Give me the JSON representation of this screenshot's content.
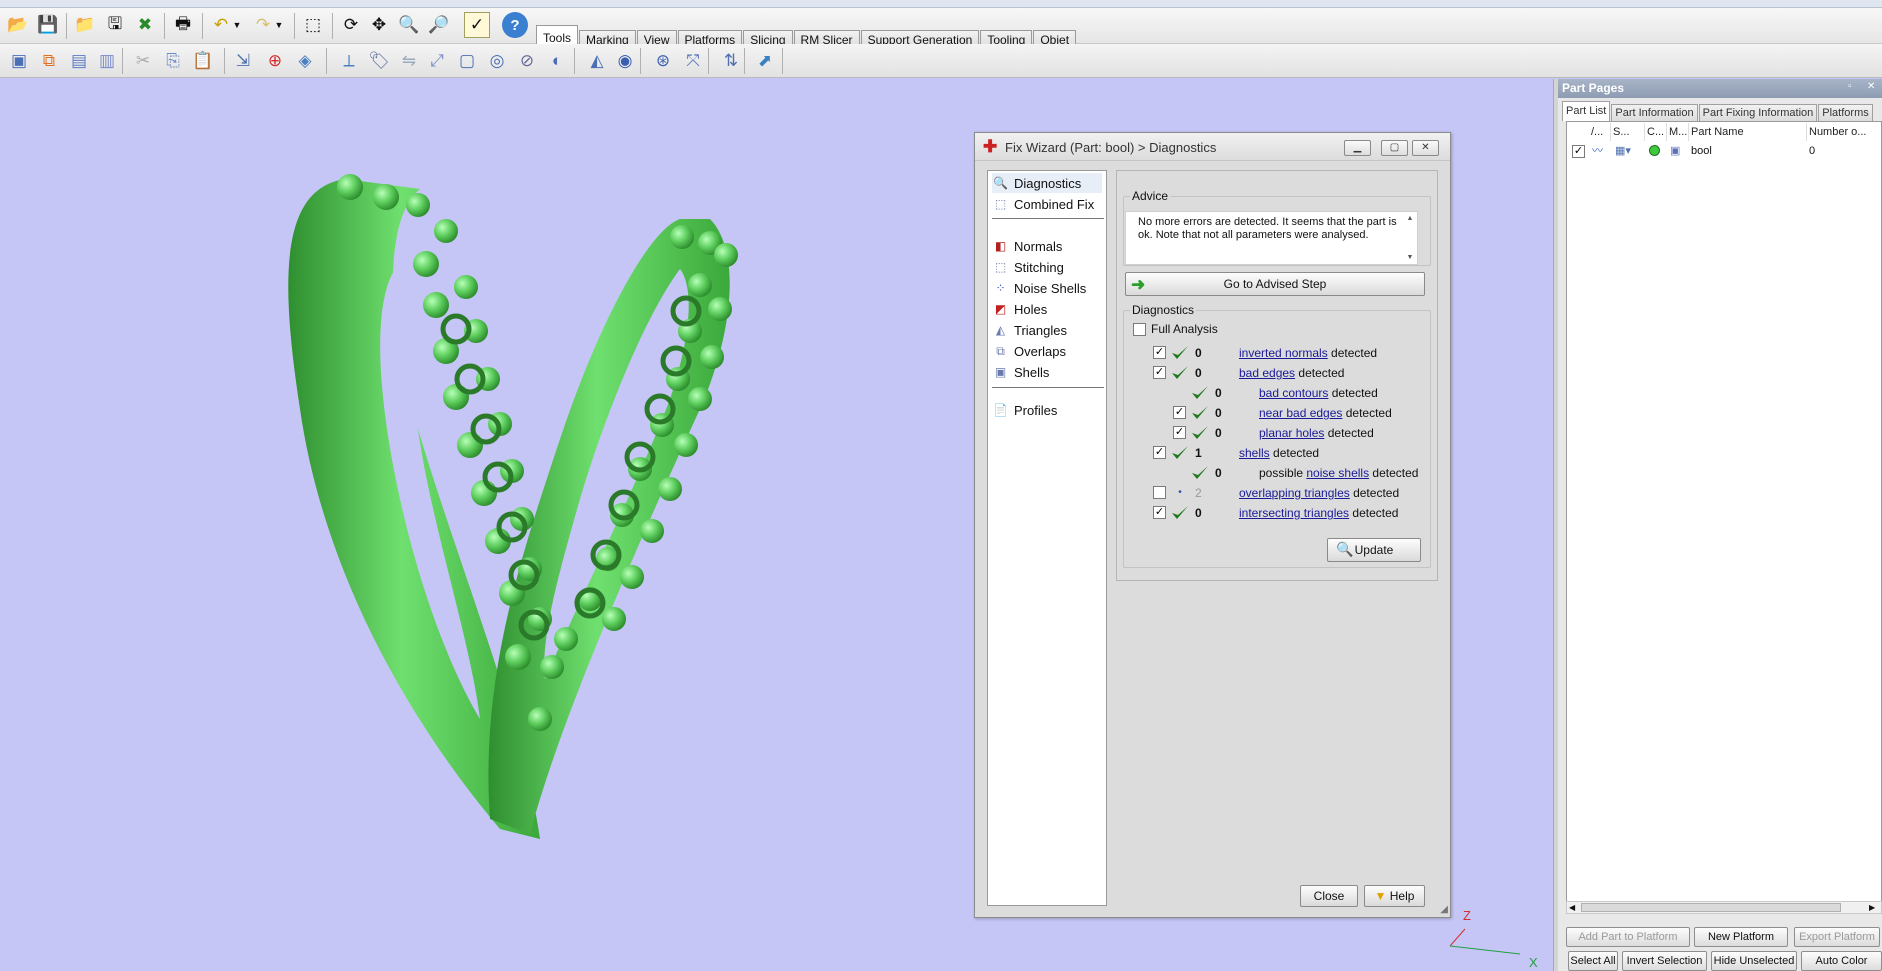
{
  "toolbar": {
    "row1_icons": [
      "open-icon",
      "save-icon",
      "open-folder-icon",
      "save-as-icon",
      "close-part-icon",
      "print-icon",
      "undo-icon",
      "undo-dropdown-icon",
      "redo-icon",
      "redo-dropdown-icon",
      "select-icon",
      "rotate-icon",
      "pan-icon",
      "zoom-icon",
      "zoom-window-icon",
      "checklist-icon",
      "help-icon"
    ],
    "row2_icons": [
      "import-part-icon",
      "part-tools-icon",
      "cut-icon",
      "duplicate-icon",
      "scissors-icon",
      "copy-icon",
      "paste-icon",
      "translate-icon",
      "add-part-icon",
      "unify-icon",
      "measure-icon",
      "label-icon",
      "mirror-icon",
      "scale-icon",
      "box-icon",
      "hollow-icon",
      "section-icon",
      "shade-icon",
      "perspective-icon",
      "render-icon",
      "sphere-icon",
      "transform-icon",
      "sort-icon",
      "export-icon"
    ],
    "tabs": [
      "Tools",
      "Marking",
      "View",
      "Platforms",
      "Slicing",
      "RM Slicer",
      "Support Generation",
      "Tooling",
      "Objet"
    ],
    "active_tab": "Tools"
  },
  "viewport": {
    "axis_labels": {
      "z": "Z",
      "x": "X"
    }
  },
  "wizard": {
    "title": "Fix Wizard (Part: bool) > Diagnostics",
    "nav_top": [
      {
        "label": "Diagnostics",
        "icon": "magnifier-icon"
      },
      {
        "label": "Combined Fix",
        "icon": "cube-icon"
      }
    ],
    "nav_steps": [
      {
        "label": "Normals",
        "icon": "normals-icon"
      },
      {
        "label": "Stitching",
        "icon": "stitching-icon"
      },
      {
        "label": "Noise Shells",
        "icon": "noise-shells-icon"
      },
      {
        "label": "Holes",
        "icon": "holes-icon"
      },
      {
        "label": "Triangles",
        "icon": "triangles-icon"
      },
      {
        "label": "Overlaps",
        "icon": "overlaps-icon"
      },
      {
        "label": "Shells",
        "icon": "shells-icon"
      }
    ],
    "nav_bottom": [
      {
        "label": "Profiles",
        "icon": "profiles-icon"
      }
    ],
    "advice_label": "Advice",
    "advice_text": "No more errors are detected. It seems that the part is ok. Note that not all parameters were analysed.",
    "advised_step_button": "Go to Advised Step",
    "diagnostics_label": "Diagnostics",
    "full_analysis_label": "Full Analysis",
    "full_analysis_checked": false,
    "rows": [
      {
        "checked": true,
        "has_checkbox": true,
        "ok": true,
        "count": "0",
        "prefix": "",
        "link": "inverted normals",
        "suffix": " detected",
        "level": 0
      },
      {
        "checked": true,
        "has_checkbox": true,
        "ok": true,
        "count": "0",
        "prefix": "",
        "link": "bad edges",
        "suffix": " detected",
        "level": 0
      },
      {
        "checked": false,
        "has_checkbox": false,
        "ok": true,
        "count": "0",
        "prefix": "",
        "link": "bad contours",
        "suffix": " detected",
        "level": 1
      },
      {
        "checked": true,
        "has_checkbox": true,
        "ok": true,
        "count": "0",
        "prefix": "",
        "link": "near bad edges",
        "suffix": " detected",
        "level": 1
      },
      {
        "checked": true,
        "has_checkbox": true,
        "ok": true,
        "count": "0",
        "prefix": "",
        "link": "planar holes",
        "suffix": " detected",
        "level": 1
      },
      {
        "checked": true,
        "has_checkbox": true,
        "ok": true,
        "count": "1",
        "prefix": "",
        "link": "shells",
        "suffix": " detected",
        "level": 0
      },
      {
        "checked": false,
        "has_checkbox": false,
        "ok": true,
        "count": "0",
        "prefix": "possible ",
        "link": "noise shells",
        "suffix": " detected",
        "level": 1
      },
      {
        "checked": false,
        "has_checkbox": true,
        "ok": false,
        "count": "2",
        "prefix": "",
        "link": "overlapping triangles",
        "suffix": " detected",
        "level": 0
      },
      {
        "checked": true,
        "has_checkbox": true,
        "ok": true,
        "count": "0",
        "prefix": "",
        "link": "intersecting triangles",
        "suffix": " detected",
        "level": 0
      }
    ],
    "update_button": "Update",
    "close_button": "Close",
    "help_button": "Help"
  },
  "parts": {
    "title": "Part Pages",
    "tabs": [
      "Part List",
      "Part Information",
      "Part Fixing Information",
      "Platforms"
    ],
    "active_tab": "Part List",
    "columns": [
      "/...",
      "S...",
      "C...",
      "M...",
      "Part Name",
      "Number o..."
    ],
    "row": {
      "checked": true,
      "name": "bool",
      "number": "0"
    },
    "buttons_row1": [
      {
        "label": "Add Part to Platform",
        "enabled": false
      },
      {
        "label": "New Platform",
        "enabled": true
      },
      {
        "label": "Export Platform",
        "enabled": false
      }
    ],
    "buttons_row2": [
      {
        "label": "Select All",
        "enabled": true
      },
      {
        "label": "Invert Selection",
        "enabled": true
      },
      {
        "label": "Hide Unselected",
        "enabled": true
      },
      {
        "label": "Auto Color",
        "enabled": true
      }
    ]
  },
  "colors": {
    "viewport_bg": "#c6c6f6",
    "model_green": "#4fc04f",
    "link_blue": "#1a1a99",
    "check_green": "#1f7a1f"
  }
}
